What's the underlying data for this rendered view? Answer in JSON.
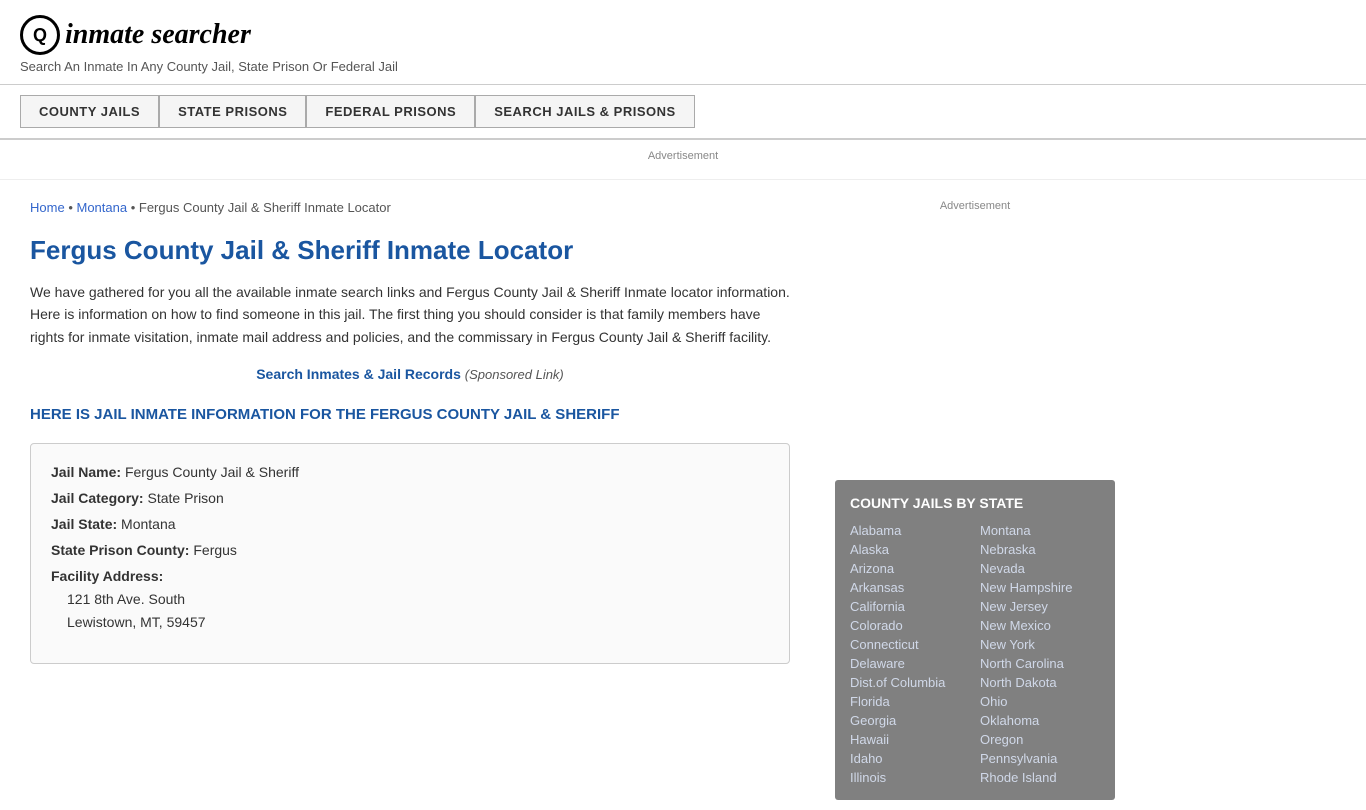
{
  "header": {
    "logo_letter": "i",
    "logo_text_part1": "inmate",
    "logo_text_part2": "searcher",
    "tagline": "Search An Inmate In Any County Jail, State Prison Or Federal Jail"
  },
  "nav": {
    "buttons": [
      {
        "label": "COUNTY JAILS",
        "id": "county-jails"
      },
      {
        "label": "STATE PRISONS",
        "id": "state-prisons"
      },
      {
        "label": "FEDERAL PRISONS",
        "id": "federal-prisons"
      },
      {
        "label": "SEARCH JAILS & PRISONS",
        "id": "search-jails"
      }
    ]
  },
  "ad": {
    "label": "Advertisement"
  },
  "breadcrumb": {
    "home": "Home",
    "state": "Montana",
    "current": "Fergus County Jail & Sheriff Inmate Locator"
  },
  "page": {
    "title": "Fergus County Jail & Sheriff Inmate Locator",
    "description": "We have gathered for you all the available inmate search links and Fergus County Jail & Sheriff Inmate locator information. Here is information on how to find someone in this jail. The first thing you should consider is that family members have rights for inmate visitation, inmate mail address and policies, and the commissary in Fergus County Jail & Sheriff facility.",
    "search_link_text": "Search Inmates & Jail Records",
    "search_link_sponsored": "(Sponsored Link)",
    "info_heading": "HERE IS JAIL INMATE INFORMATION FOR THE FERGUS COUNTY JAIL & SHERIFF"
  },
  "jail_info": {
    "name_label": "Jail Name:",
    "name_value": "Fergus County Jail & Sheriff",
    "category_label": "Jail Category:",
    "category_value": "State Prison",
    "state_label": "Jail State:",
    "state_value": "Montana",
    "county_label": "State Prison County:",
    "county_value": "Fergus",
    "address_label": "Facility Address:",
    "address_line1": "121 8th Ave. South",
    "address_line2": "Lewistown, MT, 59457"
  },
  "sidebar": {
    "ad_label": "Advertisement",
    "state_list_title": "COUNTY JAILS BY STATE",
    "col1": [
      "Alabama",
      "Alaska",
      "Arizona",
      "Arkansas",
      "California",
      "Colorado",
      "Connecticut",
      "Delaware",
      "Dist.of Columbia",
      "Florida",
      "Georgia",
      "Hawaii",
      "Idaho",
      "Illinois"
    ],
    "col2": [
      "Montana",
      "Nebraska",
      "Nevada",
      "New Hampshire",
      "New Jersey",
      "New Mexico",
      "New York",
      "North Carolina",
      "North Dakota",
      "Ohio",
      "Oklahoma",
      "Oregon",
      "Pennsylvania",
      "Rhode Island"
    ]
  }
}
